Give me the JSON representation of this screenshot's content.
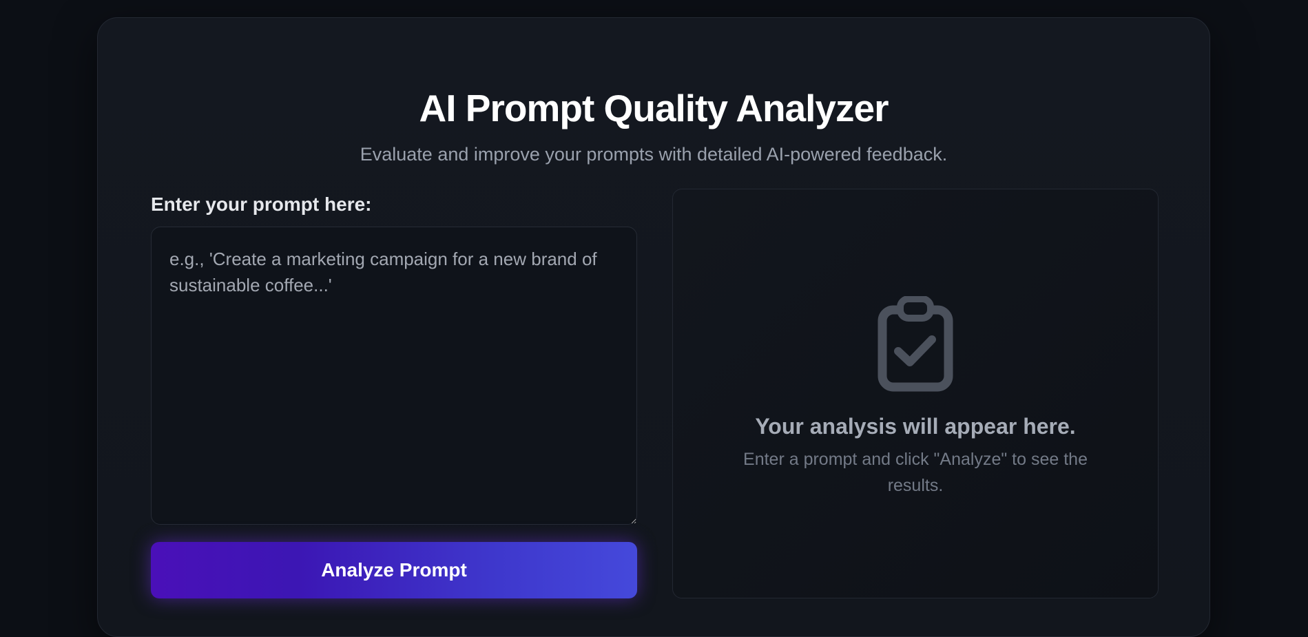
{
  "header": {
    "title": "AI Prompt Quality Analyzer",
    "subtitle": "Evaluate and improve your prompts with detailed AI-powered feedback."
  },
  "prompt": {
    "label": "Enter your prompt here:",
    "value": "",
    "placeholder": "e.g., 'Create a marketing campaign for a new brand of sustainable coffee...'"
  },
  "actions": {
    "analyze_label": "Analyze Prompt"
  },
  "results": {
    "icon": "clipboard-check-icon",
    "heading": "Your analysis will appear here.",
    "hint": "Enter a prompt and click \"Analyze\" to see the results."
  },
  "colors": {
    "background": "#0c0f15",
    "card": "#141820",
    "button_gradient_start": "#4a10b8",
    "button_gradient_end": "#4549db",
    "icon": "#4b515c"
  }
}
